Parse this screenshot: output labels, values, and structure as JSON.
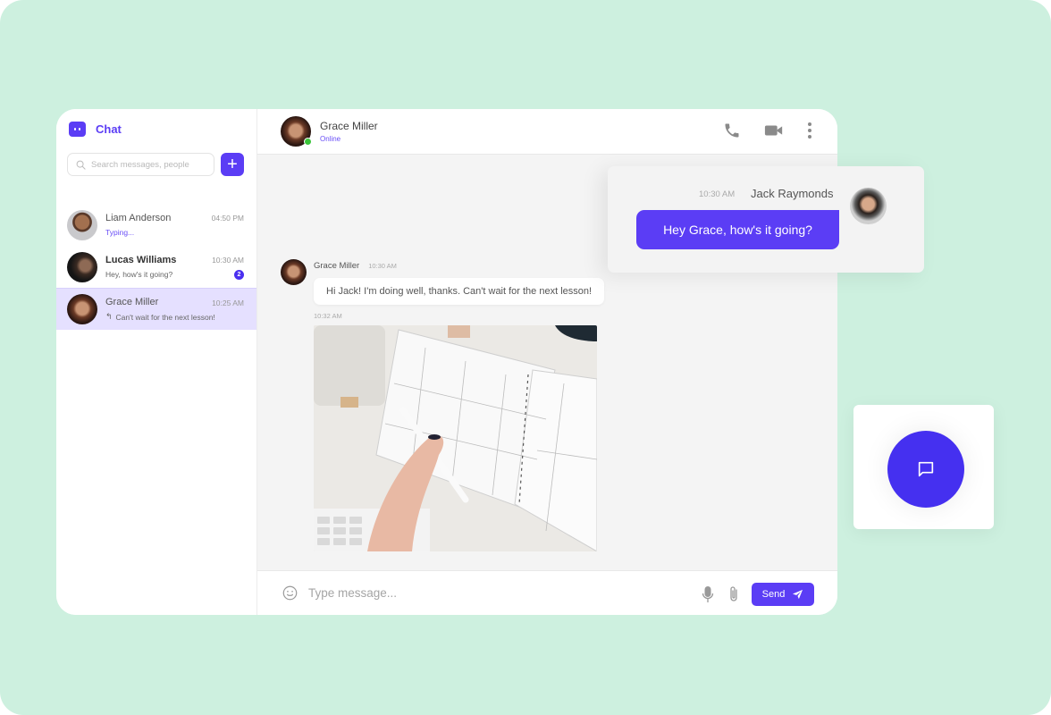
{
  "brand": {
    "label": "Chat",
    "icon": "chat-bot-icon"
  },
  "search": {
    "placeholder": "Search messages, people",
    "icon": "search-icon"
  },
  "add_button": {
    "label": "+",
    "icon": "plus-icon"
  },
  "conversations": [
    {
      "name": "Liam Anderson",
      "subtitle": "Typing...",
      "time": "04:50 PM",
      "typing": true,
      "unread": null,
      "active": false
    },
    {
      "name": "Lucas Williams",
      "subtitle": "Hey, how's it going?",
      "time": "10:30 AM",
      "typing": false,
      "unread": "2",
      "active": false
    },
    {
      "name": "Grace Miller",
      "subtitle": "Can't wait for the next lesson!",
      "time": "10:25 AM",
      "typing": false,
      "unread": null,
      "active": true,
      "reply_icon": "↰"
    }
  ],
  "header": {
    "name": "Grace Miller",
    "status": "Online",
    "actions": [
      "phone-icon",
      "video-icon",
      "more-vertical-icon"
    ]
  },
  "messages": [
    {
      "sender": "Grace Miller",
      "time": "10:30 AM",
      "text": "Hi Jack! I'm doing well, thanks. Can't wait for the next lesson!"
    },
    {
      "sender": "Grace Miller",
      "time": "10:32 AM",
      "type": "image",
      "alt": "Hand writing in a weekly planner on a white desk"
    }
  ],
  "composer": {
    "placeholder": "Type message...",
    "send_label": "Send",
    "icons": [
      "emoji-icon",
      "microphone-icon",
      "paperclip-icon",
      "send-icon"
    ]
  },
  "floating_message": {
    "sender": "Jack Raymonds",
    "time": "10:30 AM",
    "text": "Hey Grace, how's it going?"
  },
  "fab": {
    "icon": "message-square-icon"
  },
  "colors": {
    "accent": "#5b3df5",
    "background": "#cdf0df",
    "online": "#3ac43a",
    "active_row": "#e5e0ff"
  }
}
